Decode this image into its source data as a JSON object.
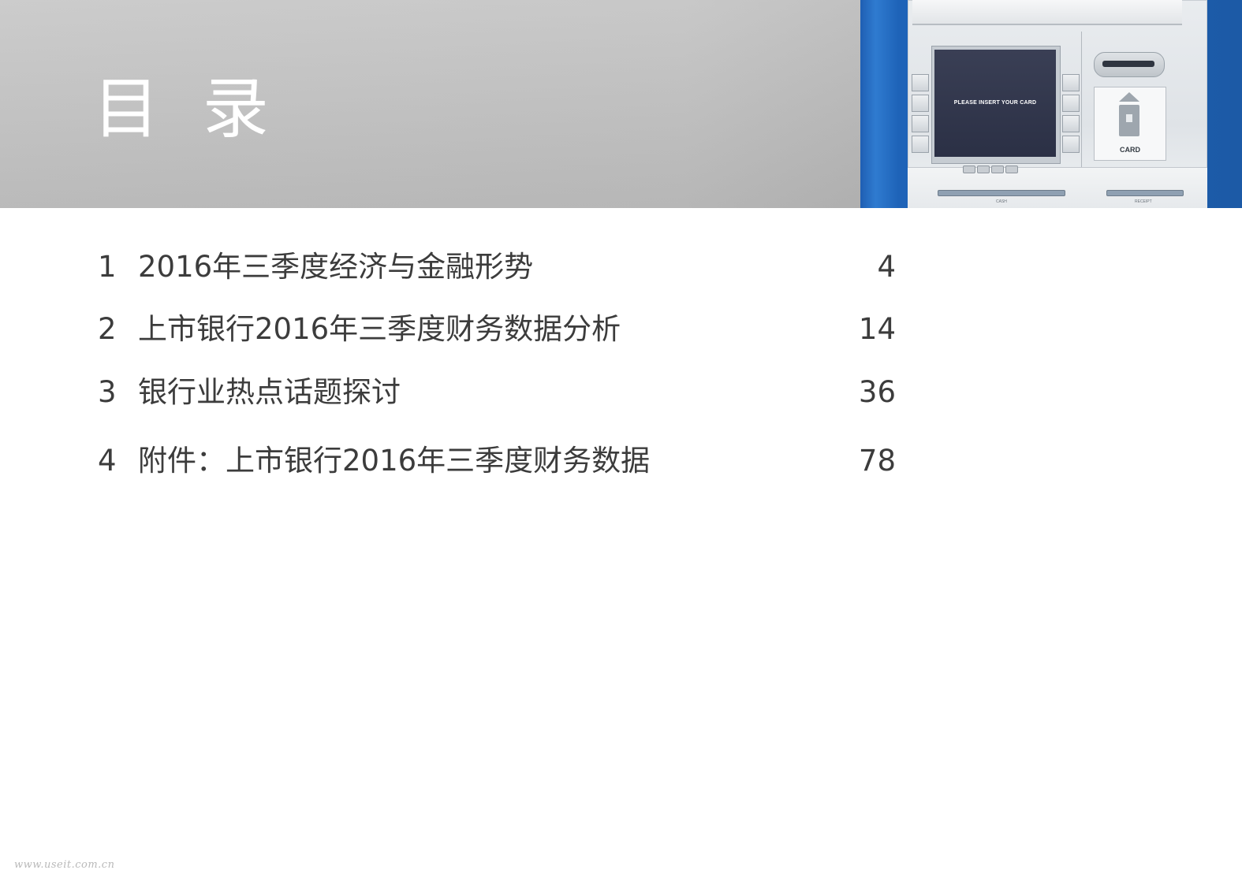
{
  "header": {
    "title": "目 录"
  },
  "atm_image": {
    "screen_text": "PLEASE INSERT YOUR CARD",
    "card_label": "CARD",
    "cash_label": "CASH",
    "receipt_label": "RECEIPT"
  },
  "toc": {
    "entries": [
      {
        "number": "1",
        "title": "2016年三季度经济与金融形势",
        "page": "4"
      },
      {
        "number": "2",
        "title": "上市银行2016年三季度财务数据分析",
        "page": "14"
      },
      {
        "number": "3",
        "title": "银行业热点话题探讨",
        "page": "36"
      },
      {
        "number": "4",
        "title": "附件：上市银行2016年三季度财务数据",
        "page": "78"
      }
    ]
  },
  "watermark": "www.useit.com.cn"
}
